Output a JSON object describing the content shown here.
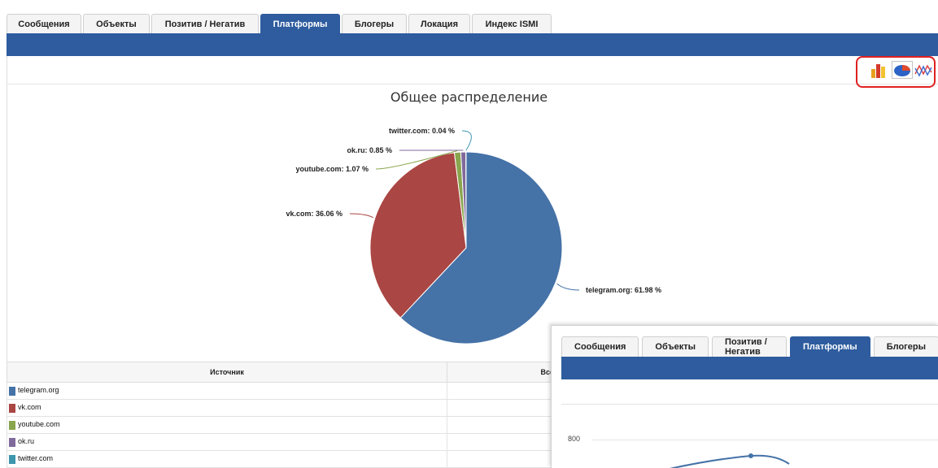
{
  "tabs": [
    "Сообщения",
    "Объекты",
    "Позитив / Негатив",
    "Платформы",
    "Блогеры",
    "Локация",
    "Индекс ISMI"
  ],
  "active_tab": "Платформы",
  "chart_icons": [
    "bar-chart-icon",
    "pie-chart-icon",
    "line-chart-icon"
  ],
  "chart_data": {
    "type": "pie",
    "title": "Общее распределение",
    "slices": [
      {
        "name": "telegram.org",
        "value": 61.98,
        "label": "telegram.org: 61.98 %",
        "color": "#4572a7"
      },
      {
        "name": "vk.com",
        "value": 36.06,
        "label": "vk.com: 36.06 %",
        "color": "#aa4643"
      },
      {
        "name": "youtube.com",
        "value": 1.07,
        "label": "youtube.com: 1.07 %",
        "color": "#89a54e"
      },
      {
        "name": "ok.ru",
        "value": 0.85,
        "label": "ok.ru: 0.85 %",
        "color": "#80699b"
      },
      {
        "name": "twitter.com",
        "value": 0.04,
        "label": "twitter.com: 0.04 %",
        "color": "#3d96ae"
      }
    ]
  },
  "table": {
    "headers": [
      "Источник",
      "Все"
    ],
    "rows": [
      {
        "name": "telegram.org",
        "color": "#4572a7"
      },
      {
        "name": "vk.com",
        "color": "#aa4643"
      },
      {
        "name": "youtube.com",
        "color": "#89a54e"
      },
      {
        "name": "ok.ru",
        "color": "#80699b"
      },
      {
        "name": "twitter.com",
        "color": "#3d96ae"
      }
    ]
  },
  "overlay": {
    "tabs": [
      "Сообщения",
      "Объекты",
      "Позитив / Негатив",
      "Платформы",
      "Блогеры"
    ],
    "active_tab": "Платформы",
    "y_tick": "800"
  }
}
